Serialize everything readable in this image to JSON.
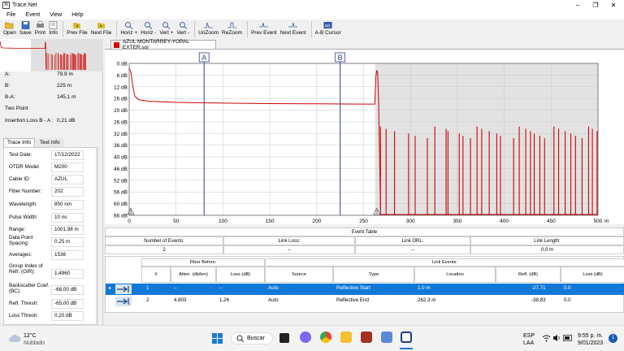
{
  "window": {
    "title": "Trace.Net",
    "icon_letter": "N"
  },
  "menu": [
    "File",
    "Event",
    "View",
    "Help"
  ],
  "toolbar": [
    {
      "label": "Open",
      "icon": "folder-open-icon",
      "has_dropdown": true
    },
    {
      "label": "Save",
      "icon": "save-icon"
    },
    {
      "label": "Print",
      "icon": "print-icon"
    },
    {
      "label": "Info",
      "icon": "info-icon"
    },
    {
      "label": "Prev File",
      "icon": "prev-file-icon"
    },
    {
      "label": "Next File",
      "icon": "next-file-icon"
    },
    {
      "label": "Horiz +",
      "icon": "zoom-in-horizontal-icon"
    },
    {
      "label": "Horiz -",
      "icon": "zoom-out-horizontal-icon"
    },
    {
      "label": "Vert +",
      "icon": "zoom-in-vertical-icon"
    },
    {
      "label": "Vert -",
      "icon": "zoom-out-vertical-icon"
    },
    {
      "label": "UnZoom",
      "icon": "unzoom-icon"
    },
    {
      "label": "ReZoom",
      "icon": "rezoom-icon"
    },
    {
      "label": "Prev Event",
      "icon": "prev-event-icon"
    },
    {
      "label": "Next Event",
      "icon": "next-event-icon"
    },
    {
      "label": "A-B Cursor",
      "icon": "ab-cursor-icon"
    }
  ],
  "cursors": {
    "a_label": "A:",
    "a_value": "79,9 m",
    "b_label": "B:",
    "b_value": "225 m",
    "ba_label": "B-A:",
    "ba_value": "145,1 m",
    "mode": "Two Point",
    "il_label": "Insertion Loss B - A :",
    "il_value": "0,21 dB"
  },
  "info_tabs": [
    "Trace Info",
    "Text Info"
  ],
  "trace_info": [
    {
      "label": "Test Date:",
      "value": "17/12/2022"
    },
    {
      "label": "OTDR Model",
      "value": "M200"
    },
    {
      "label": "Cable ID:",
      "value": "AZUL"
    },
    {
      "label": "Fiber Number:",
      "value": "202"
    },
    {
      "label": "Wavelength:",
      "value": "850 nm"
    },
    {
      "label": "Pulse Width:",
      "value": "10 ns"
    },
    {
      "label": "Range:",
      "value": "1001,98 m"
    },
    {
      "label": "Data Point Spacing:",
      "value": "0,25 m"
    },
    {
      "label": "Averages:",
      "value": "1536"
    },
    {
      "label": "Group Index of Refr. (GIR):",
      "value": "1,4960"
    },
    {
      "label": "Backscatter Coef. (BC):",
      "value": "-68,00 dB"
    },
    {
      "label": "Refl. Thresh:",
      "value": "-65,00 dB"
    },
    {
      "label": "Loss Thresh:",
      "value": "0,20 dB"
    }
  ],
  "doc_tab": "AZUL MONTARREY-YOPAL EXTER.sor",
  "chart_data": {
    "type": "line",
    "x_unit": "m",
    "xlim": [
      0,
      500
    ],
    "ylim": [
      0,
      65
    ],
    "y_inverted": true,
    "xticks": [
      "0",
      "50",
      "100",
      "150",
      "200",
      "250",
      "300",
      "350",
      "400",
      "450",
      "500"
    ],
    "yticks": [
      "0 dB",
      "6 dB",
      "12 dB",
      "16 dB",
      "20 dB",
      "26 dB",
      "32 dB",
      "36 dB",
      "40 dB",
      "46 dB",
      "52 dB",
      "56 dB",
      "60 dB",
      "66 dB"
    ],
    "cursor_a": {
      "label": "A",
      "x": 79.9
    },
    "cursor_b": {
      "label": "B",
      "x": 225
    },
    "event_markers": [
      {
        "label": "1",
        "x": 0
      },
      {
        "label": "2",
        "x": 262.3
      }
    ],
    "trace": [
      [
        0,
        2
      ],
      [
        2,
        4
      ],
      [
        4,
        10
      ],
      [
        6,
        14
      ],
      [
        10,
        15.5
      ],
      [
        20,
        16.2
      ],
      [
        50,
        16.7
      ],
      [
        100,
        17.0
      ],
      [
        150,
        17.2
      ],
      [
        200,
        17.3
      ],
      [
        250,
        17.4
      ],
      [
        262,
        17.4
      ],
      [
        263,
        6
      ],
      [
        264,
        3
      ],
      [
        265,
        4
      ],
      [
        266,
        16
      ],
      [
        268,
        62
      ]
    ],
    "noise_spikes": [
      268,
      274,
      283,
      298,
      305,
      318,
      326,
      338,
      340,
      352,
      356,
      364,
      371,
      376,
      384,
      392,
      396,
      410,
      416,
      423,
      428,
      432,
      438,
      443,
      453,
      458,
      465,
      471,
      476,
      483,
      490,
      494,
      499
    ],
    "noise_color": "#cc0000",
    "trace_color": "#cc0000",
    "shade_from": 262.3,
    "grid": true
  },
  "event_table": {
    "title": "Event Table",
    "summary_headers": [
      "Number of Events:",
      "Link Loss:",
      "Link ORL:",
      "Link Length:"
    ],
    "summary_values": [
      "2",
      "--",
      "--",
      "0,0 m"
    ],
    "group_fiber_before": "Fiber Before:",
    "group_link_events": "Link Events:",
    "headers": [
      "#",
      "Atten. (db/km)",
      "Loss (dB)",
      "Source",
      "Type",
      "Location",
      "Refl. (dB)",
      "Loss (dB)"
    ],
    "rows": [
      {
        "num": "1",
        "atten": "--",
        "loss_before": "--",
        "source": "Auto",
        "type": "Reflective Start",
        "location": "1.0 m",
        "refl": "-27.71",
        "loss": "0.0",
        "selected": true
      },
      {
        "num": "2",
        "atten": "4.803",
        "loss_before": "1.26",
        "source": "Auto",
        "type": "Reflective End",
        "location": "262.3 m",
        "refl": "-38.83",
        "loss": "0.0",
        "selected": false
      }
    ]
  },
  "taskbar": {
    "weather_temp": "12°C",
    "weather_desc": "Nublado",
    "search_label": "Buscar",
    "lang": "ESP",
    "lang2": "LAA",
    "time": "9:55 p. m.",
    "date": "9/01/2023",
    "notif_count": "1"
  }
}
